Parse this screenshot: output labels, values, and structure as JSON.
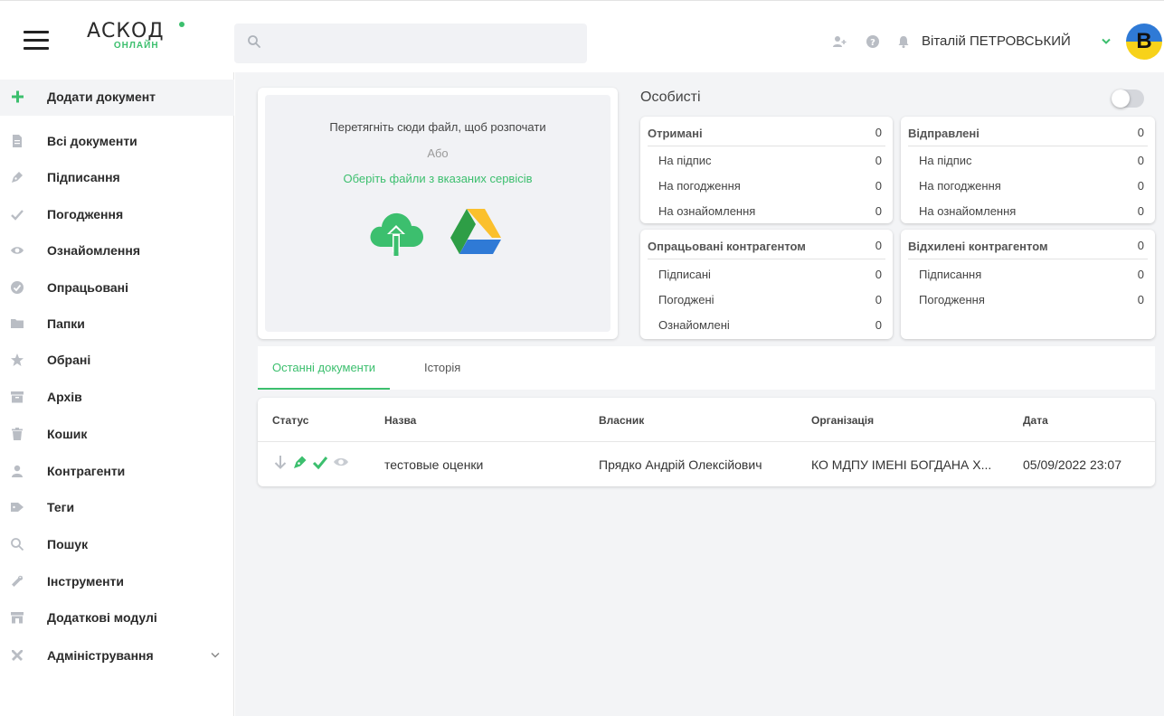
{
  "header": {
    "logo_main": "АСКОД",
    "logo_sub": "ОНЛАЙН",
    "search_placeholder": "",
    "user_name": "Віталій ПЕТРОВСЬКИЙ",
    "avatar_letter": "В"
  },
  "sidebar": {
    "items": [
      {
        "label": "Додати документ",
        "icon": "plus-icon"
      },
      {
        "label": "Всі документи",
        "icon": "document-icon"
      },
      {
        "label": "Підписання",
        "icon": "pen-icon"
      },
      {
        "label": "Погодження",
        "icon": "check-icon"
      },
      {
        "label": "Ознайомлення",
        "icon": "eye-icon"
      },
      {
        "label": "Опрацьовані",
        "icon": "check-circle-icon"
      },
      {
        "label": "Папки",
        "icon": "folder-icon"
      },
      {
        "label": "Обрані",
        "icon": "star-icon"
      },
      {
        "label": "Архів",
        "icon": "archive-icon"
      },
      {
        "label": "Кошик",
        "icon": "trash-icon"
      },
      {
        "label": "Контрагенти",
        "icon": "user-icon"
      },
      {
        "label": "Теги",
        "icon": "tag-icon"
      },
      {
        "label": "Пошук",
        "icon": "search-icon"
      },
      {
        "label": "Інструменти",
        "icon": "wrench-icon"
      },
      {
        "label": "Додаткові модулі",
        "icon": "store-icon"
      },
      {
        "label": "Адміністрування",
        "icon": "tools-icon"
      }
    ]
  },
  "upload": {
    "drag_text": "Перетягніть сюди файл, щоб розпочати",
    "or_text": "Або",
    "choose_text": "Оберіть файли з вказаних сервісів"
  },
  "personal": {
    "title": "Особисті",
    "toggle_on": false
  },
  "stats": {
    "received": {
      "title": "Отримані",
      "value": "0",
      "rows": [
        {
          "label": "На підпис",
          "value": "0"
        },
        {
          "label": "На погодження",
          "value": "0"
        },
        {
          "label": "На ознайомлення",
          "value": "0"
        }
      ]
    },
    "sent": {
      "title": "Відправлені",
      "value": "0",
      "rows": [
        {
          "label": "На підпис",
          "value": "0"
        },
        {
          "label": "На погодження",
          "value": "0"
        },
        {
          "label": "На ознайомлення",
          "value": "0"
        }
      ]
    },
    "processed": {
      "title": "Опрацьовані контрагентом",
      "value": "0",
      "rows": [
        {
          "label": "Підписані",
          "value": "0"
        },
        {
          "label": "Погоджені",
          "value": "0"
        },
        {
          "label": "Ознайомлені",
          "value": "0"
        }
      ]
    },
    "rejected": {
      "title": "Відхилені контрагентом",
      "value": "0",
      "rows": [
        {
          "label": "Підписання",
          "value": "0"
        },
        {
          "label": "Погодження",
          "value": "0"
        }
      ]
    }
  },
  "tabs": {
    "recent": "Останні документи",
    "history": "Історія"
  },
  "table": {
    "headers": {
      "status": "Статус",
      "name": "Назва",
      "owner": "Власник",
      "org": "Організація",
      "date": "Дата"
    },
    "rows": [
      {
        "name": "тестовые оценки",
        "owner": "Прядко Андрій Олексійович",
        "org": "КО МДПУ ІМЕНІ БОГДАНА Х...",
        "date": "05/09/2022 23:07"
      }
    ]
  },
  "colors": {
    "accent": "#3cbf6e",
    "icon_gray": "#b9bdc4",
    "background": "#f3f4f6"
  }
}
